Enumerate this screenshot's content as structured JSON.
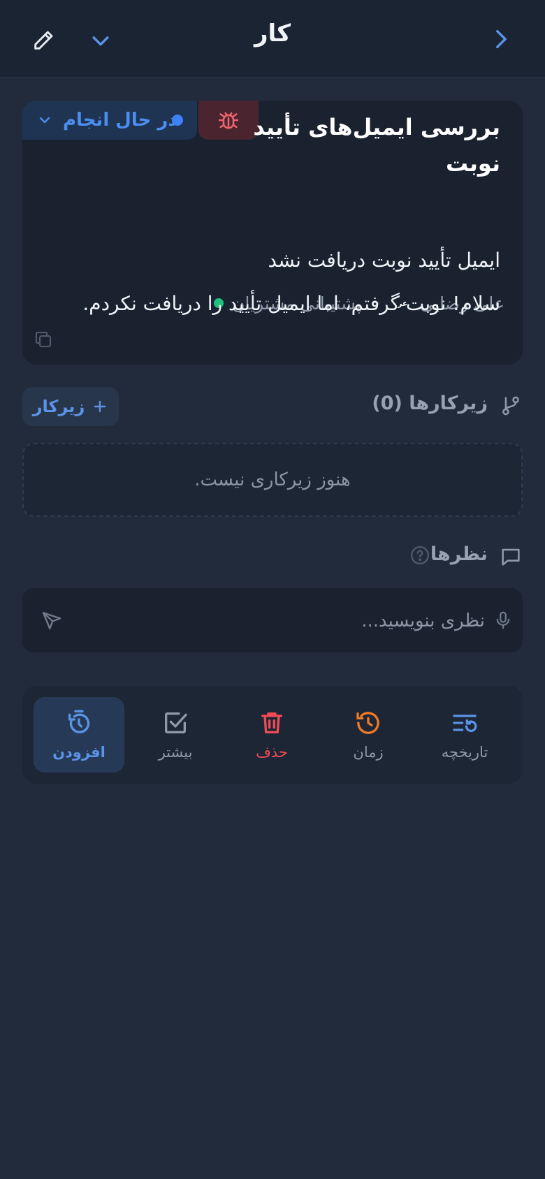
{
  "header": {
    "title": "کار"
  },
  "task": {
    "title_line1": "بررسی ایمیل‌های تأیید",
    "title_line2": "نوبت",
    "status": "در حال انجام",
    "type_icon": "bug-icon",
    "team": "پشتیبانی مشتریان",
    "assignee_initials": "عر",
    "assignee": "علی رضایی",
    "subject": "ایمیل تأیید نوبت دریافت نشد",
    "body": "سلام! نوبت گرفتم، اما ایمیل تأیید را دریافت نکردم."
  },
  "subtasks": {
    "label": "زیرکارها (0)",
    "add_label": "زیرکار",
    "empty_text": "هنوز زیرکاری نیست."
  },
  "comments": {
    "label": "نظرها",
    "placeholder": "نظری بنویسید..."
  },
  "actions": [
    {
      "label": "افزودن",
      "icon": "timer-icon",
      "color": "#5b93e6"
    },
    {
      "label": "بیشتر",
      "icon": "checkbox-icon",
      "color": "#8f99a8"
    },
    {
      "label": "حذف",
      "icon": "trash-icon",
      "color": "#ef4b55"
    },
    {
      "label": "زمان",
      "icon": "history-icon",
      "color": "#f07a24"
    },
    {
      "label": "تاریخچه",
      "icon": "list-history-icon",
      "color": "#5b93e6"
    }
  ],
  "colors": {
    "background": "#212b3b",
    "card": "#1a2230",
    "accent": "#3d82f5",
    "danger": "#ef4b55",
    "success": "#1fbf7c"
  }
}
